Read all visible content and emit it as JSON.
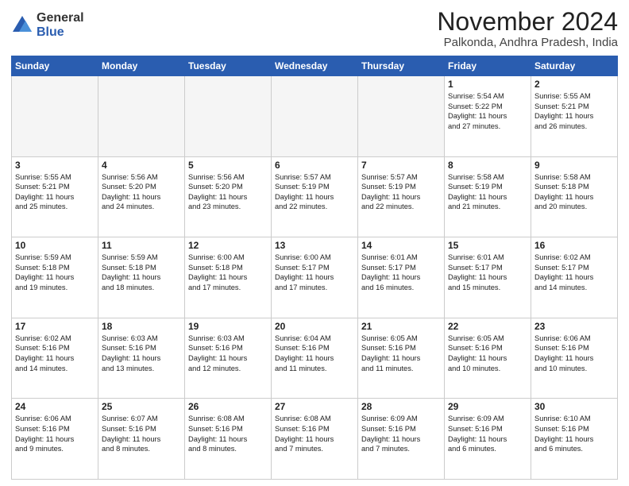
{
  "header": {
    "logo_general": "General",
    "logo_blue": "Blue",
    "month_title": "November 2024",
    "location": "Palkonda, Andhra Pradesh, India"
  },
  "days_of_week": [
    "Sunday",
    "Monday",
    "Tuesday",
    "Wednesday",
    "Thursday",
    "Friday",
    "Saturday"
  ],
  "weeks": [
    [
      {
        "day": "",
        "info": ""
      },
      {
        "day": "",
        "info": ""
      },
      {
        "day": "",
        "info": ""
      },
      {
        "day": "",
        "info": ""
      },
      {
        "day": "",
        "info": ""
      },
      {
        "day": "1",
        "info": "Sunrise: 5:54 AM\nSunset: 5:22 PM\nDaylight: 11 hours\nand 27 minutes."
      },
      {
        "day": "2",
        "info": "Sunrise: 5:55 AM\nSunset: 5:21 PM\nDaylight: 11 hours\nand 26 minutes."
      }
    ],
    [
      {
        "day": "3",
        "info": "Sunrise: 5:55 AM\nSunset: 5:21 PM\nDaylight: 11 hours\nand 25 minutes."
      },
      {
        "day": "4",
        "info": "Sunrise: 5:56 AM\nSunset: 5:20 PM\nDaylight: 11 hours\nand 24 minutes."
      },
      {
        "day": "5",
        "info": "Sunrise: 5:56 AM\nSunset: 5:20 PM\nDaylight: 11 hours\nand 23 minutes."
      },
      {
        "day": "6",
        "info": "Sunrise: 5:57 AM\nSunset: 5:19 PM\nDaylight: 11 hours\nand 22 minutes."
      },
      {
        "day": "7",
        "info": "Sunrise: 5:57 AM\nSunset: 5:19 PM\nDaylight: 11 hours\nand 22 minutes."
      },
      {
        "day": "8",
        "info": "Sunrise: 5:58 AM\nSunset: 5:19 PM\nDaylight: 11 hours\nand 21 minutes."
      },
      {
        "day": "9",
        "info": "Sunrise: 5:58 AM\nSunset: 5:18 PM\nDaylight: 11 hours\nand 20 minutes."
      }
    ],
    [
      {
        "day": "10",
        "info": "Sunrise: 5:59 AM\nSunset: 5:18 PM\nDaylight: 11 hours\nand 19 minutes."
      },
      {
        "day": "11",
        "info": "Sunrise: 5:59 AM\nSunset: 5:18 PM\nDaylight: 11 hours\nand 18 minutes."
      },
      {
        "day": "12",
        "info": "Sunrise: 6:00 AM\nSunset: 5:18 PM\nDaylight: 11 hours\nand 17 minutes."
      },
      {
        "day": "13",
        "info": "Sunrise: 6:00 AM\nSunset: 5:17 PM\nDaylight: 11 hours\nand 17 minutes."
      },
      {
        "day": "14",
        "info": "Sunrise: 6:01 AM\nSunset: 5:17 PM\nDaylight: 11 hours\nand 16 minutes."
      },
      {
        "day": "15",
        "info": "Sunrise: 6:01 AM\nSunset: 5:17 PM\nDaylight: 11 hours\nand 15 minutes."
      },
      {
        "day": "16",
        "info": "Sunrise: 6:02 AM\nSunset: 5:17 PM\nDaylight: 11 hours\nand 14 minutes."
      }
    ],
    [
      {
        "day": "17",
        "info": "Sunrise: 6:02 AM\nSunset: 5:16 PM\nDaylight: 11 hours\nand 14 minutes."
      },
      {
        "day": "18",
        "info": "Sunrise: 6:03 AM\nSunset: 5:16 PM\nDaylight: 11 hours\nand 13 minutes."
      },
      {
        "day": "19",
        "info": "Sunrise: 6:03 AM\nSunset: 5:16 PM\nDaylight: 11 hours\nand 12 minutes."
      },
      {
        "day": "20",
        "info": "Sunrise: 6:04 AM\nSunset: 5:16 PM\nDaylight: 11 hours\nand 11 minutes."
      },
      {
        "day": "21",
        "info": "Sunrise: 6:05 AM\nSunset: 5:16 PM\nDaylight: 11 hours\nand 11 minutes."
      },
      {
        "day": "22",
        "info": "Sunrise: 6:05 AM\nSunset: 5:16 PM\nDaylight: 11 hours\nand 10 minutes."
      },
      {
        "day": "23",
        "info": "Sunrise: 6:06 AM\nSunset: 5:16 PM\nDaylight: 11 hours\nand 10 minutes."
      }
    ],
    [
      {
        "day": "24",
        "info": "Sunrise: 6:06 AM\nSunset: 5:16 PM\nDaylight: 11 hours\nand 9 minutes."
      },
      {
        "day": "25",
        "info": "Sunrise: 6:07 AM\nSunset: 5:16 PM\nDaylight: 11 hours\nand 8 minutes."
      },
      {
        "day": "26",
        "info": "Sunrise: 6:08 AM\nSunset: 5:16 PM\nDaylight: 11 hours\nand 8 minutes."
      },
      {
        "day": "27",
        "info": "Sunrise: 6:08 AM\nSunset: 5:16 PM\nDaylight: 11 hours\nand 7 minutes."
      },
      {
        "day": "28",
        "info": "Sunrise: 6:09 AM\nSunset: 5:16 PM\nDaylight: 11 hours\nand 7 minutes."
      },
      {
        "day": "29",
        "info": "Sunrise: 6:09 AM\nSunset: 5:16 PM\nDaylight: 11 hours\nand 6 minutes."
      },
      {
        "day": "30",
        "info": "Sunrise: 6:10 AM\nSunset: 5:16 PM\nDaylight: 11 hours\nand 6 minutes."
      }
    ]
  ]
}
